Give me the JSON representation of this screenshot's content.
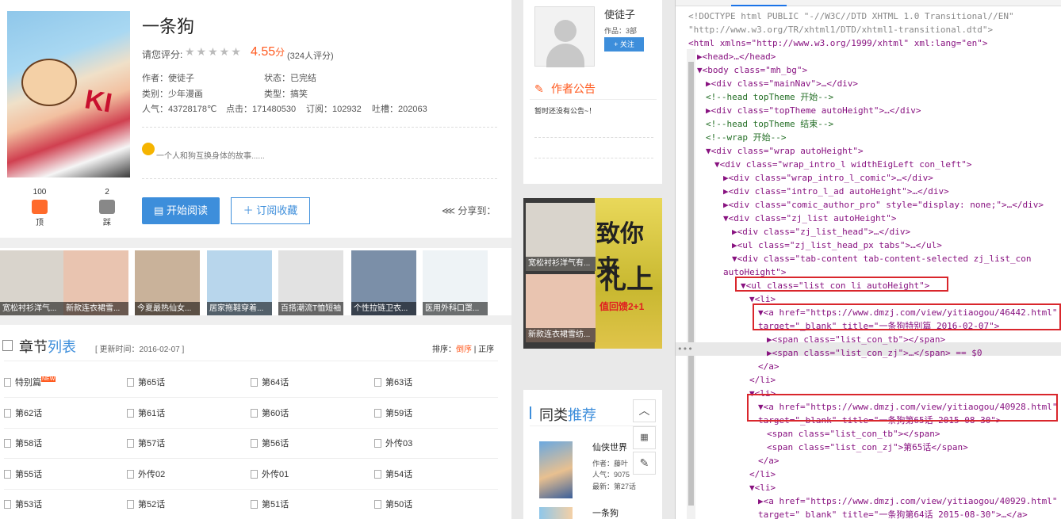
{
  "comic": {
    "title": "一条狗",
    "rate_label": "请您评分:",
    "stars": "★★★★★",
    "score": "4.55",
    "score_unit": "分",
    "rating_count": "(324人评分)",
    "author": "作者：使徒子",
    "status": "状态：已完结",
    "category": "类别：少年漫画",
    "genre": "类型：搞笑",
    "popularity": "人气：43728178℃",
    "clicks": "点击：171480530",
    "subscriptions": "订阅：102932",
    "tucao": "吐槽：202063",
    "description": "一个人和狗互换身体的故事......",
    "likes": "100",
    "like_label": "顶",
    "dislikes": "2",
    "dislike_label": "踩",
    "read_button": "开始阅读",
    "subscribe_button": "订阅收藏",
    "share_label": "分享到："
  },
  "ads": [
    {
      "caption": "宽松衬衫洋气...",
      "color": "#d9d4cc"
    },
    {
      "caption": "新款连衣裙雪...",
      "color": "#e9c4b0"
    },
    {
      "caption": "今夏最热仙女...",
      "color": "#c9b29a"
    },
    {
      "caption": "居家拖鞋穿着...",
      "color": "#b8d6ec"
    },
    {
      "caption": "百搭潮流T恤短袖",
      "color": "#e2e2e2"
    },
    {
      "caption": "个性拉链卫衣...",
      "color": "#7b8fa8"
    },
    {
      "caption": "医用外科口罩...",
      "color": "#eef3f6"
    }
  ],
  "chapters": {
    "title_a": "章节",
    "title_b": "列表",
    "updated": "[ 更新时间：2016-02-07 ]",
    "sort_label": "排序：",
    "sort_desc": "倒序",
    "sort_sep": " | ",
    "sort_asc": "正序",
    "new_badge": "NEW",
    "rows": [
      [
        "特别篇",
        "第65话",
        "第64话",
        "第63话"
      ],
      [
        "第62话",
        "第61话",
        "第60话",
        "第59话"
      ],
      [
        "第58话",
        "第57话",
        "第56话",
        "外传03"
      ],
      [
        "第55话",
        "外传02",
        "外传01",
        "第54话"
      ],
      [
        "第53话",
        "第52话",
        "第51话",
        "第50话"
      ]
    ]
  },
  "author_panel": {
    "name": "使徒子",
    "works": "作品：3部",
    "follow": "+ 关注",
    "announcement_title": "作者公告",
    "announcement_text": "暂时还没有公告~！"
  },
  "big_ad": {
    "item1": "宽松衬衫洋气有...",
    "item2": "新款连衣裙雪纺...",
    "line1": "致你来",
    "line2": "礼上",
    "line3": "值回馈2+1"
  },
  "similar": {
    "title_a": "同类",
    "title_b": "推荐",
    "books": [
      {
        "title": "仙侠世界",
        "author": "作者：藤叶",
        "pop": "人气：9075",
        "latest": "最新：第27话"
      },
      {
        "title": "一条狗",
        "author": "",
        "pop": "",
        "latest": ""
      }
    ]
  },
  "devtools": {
    "lines": [
      {
        "t": "<!DOCTYPE html PUBLIC \"-//W3C//DTD XHTML 1.0 Transitional//EN\"",
        "c": "gr",
        "i": 0
      },
      {
        "t": "\"http://www.w3.org/TR/xhtml1/DTD/xhtml1-transitional.dtd\">",
        "c": "gr",
        "i": 0
      },
      {
        "t": "<html xmlns=\"http://www.w3.org/1999/xhtml\" xml:lang=\"en\">",
        "c": "tg",
        "i": 0
      },
      {
        "t": "▶<head>…</head>",
        "c": "tg",
        "i": 1
      },
      {
        "t": "▼<body class=\"mh_bg\">",
        "c": "tg",
        "i": 1
      },
      {
        "t": "▶<div class=\"mainNav\">…</div>",
        "c": "tg",
        "i": 2
      },
      {
        "t": "<!--head topTheme 开始-->",
        "c": "cm",
        "i": 2
      },
      {
        "t": "▶<div class=\"topTheme autoHeight\">…</div>",
        "c": "tg",
        "i": 2
      },
      {
        "t": "<!--head topTheme 结束-->",
        "c": "cm",
        "i": 2
      },
      {
        "t": "<!--wrap 开始-->",
        "c": "cm",
        "i": 2
      },
      {
        "t": "▼<div class=\"wrap autoHeight\">",
        "c": "tg",
        "i": 2
      },
      {
        "t": "▼<div class=\"wrap_intro_l widthEigLeft con_left\">",
        "c": "tg",
        "i": 3
      },
      {
        "t": "▶<div class=\"wrap_intro_l_comic\">…</div>",
        "c": "tg",
        "i": 4
      },
      {
        "t": "▶<div class=\"intro_l_ad autoHeight\">…</div>",
        "c": "tg",
        "i": 4
      },
      {
        "t": "▶<div class=\"comic_author_pro\" style=\"display: none;\">…</div>",
        "c": "tg",
        "i": 4
      },
      {
        "t": "▼<div class=\"zj_list autoHeight\">",
        "c": "tg",
        "i": 4
      },
      {
        "t": "▶<div class=\"zj_list_head\">…</div>",
        "c": "tg",
        "i": 5
      },
      {
        "t": "▶<ul class=\"zj_list_head_px tabs\">…</ul>",
        "c": "tg",
        "i": 5
      },
      {
        "t": "▼<div class=\"tab-content tab-content-selected zj_list_con",
        "c": "tg",
        "i": 5
      },
      {
        "t": "autoHeight\">",
        "c": "tg",
        "i": 4
      },
      {
        "t": "▼<ul class=\"list_con_li autoHeight\">",
        "c": "tg",
        "i": 6
      },
      {
        "t": "▼<li>",
        "c": "tg",
        "i": 7
      },
      {
        "t": "▼<a href=\"https://www.dmzj.com/view/yitiaogou/46442.html\"",
        "c": "tg",
        "i": 8
      },
      {
        "t": "target=\"_blank\" title=\"一条狗特别篇 2016-02-07\">",
        "c": "tg",
        "i": 8
      },
      {
        "t": "▶<span class=\"list_con_tb\"></span>",
        "c": "tg",
        "i": 9
      },
      {
        "t": "▶<span class=\"list_con_zj\">…</span> == $0",
        "c": "tg",
        "i": 9
      },
      {
        "t": "</a>",
        "c": "tg",
        "i": 8
      },
      {
        "t": "</li>",
        "c": "tg",
        "i": 7
      },
      {
        "t": "▼<li>",
        "c": "tg",
        "i": 7
      },
      {
        "t": "▼<a href=\"https://www.dmzj.com/view/yitiaogou/40928.html\"",
        "c": "tg",
        "i": 8
      },
      {
        "t": "target=\"_blank\" title=\"一条狗第65话 2015-08-30\">",
        "c": "tg",
        "i": 8
      },
      {
        "t": "<span class=\"list_con_tb\"></span>",
        "c": "tg",
        "i": 9
      },
      {
        "t": "<span class=\"list_con_zj\">第65话</span>",
        "c": "tg",
        "i": 9
      },
      {
        "t": "</a>",
        "c": "tg",
        "i": 8
      },
      {
        "t": "</li>",
        "c": "tg",
        "i": 7
      },
      {
        "t": "▼<li>",
        "c": "tg",
        "i": 7
      },
      {
        "t": "▶<a href=\"https://www.dmzj.com/view/yitiaogou/40929.html\"",
        "c": "tg",
        "i": 8
      },
      {
        "t": "target=\"_blank\" title=\"一条狗第64话 2015-08-30\">…</a>",
        "c": "tg",
        "i": 8
      }
    ]
  }
}
